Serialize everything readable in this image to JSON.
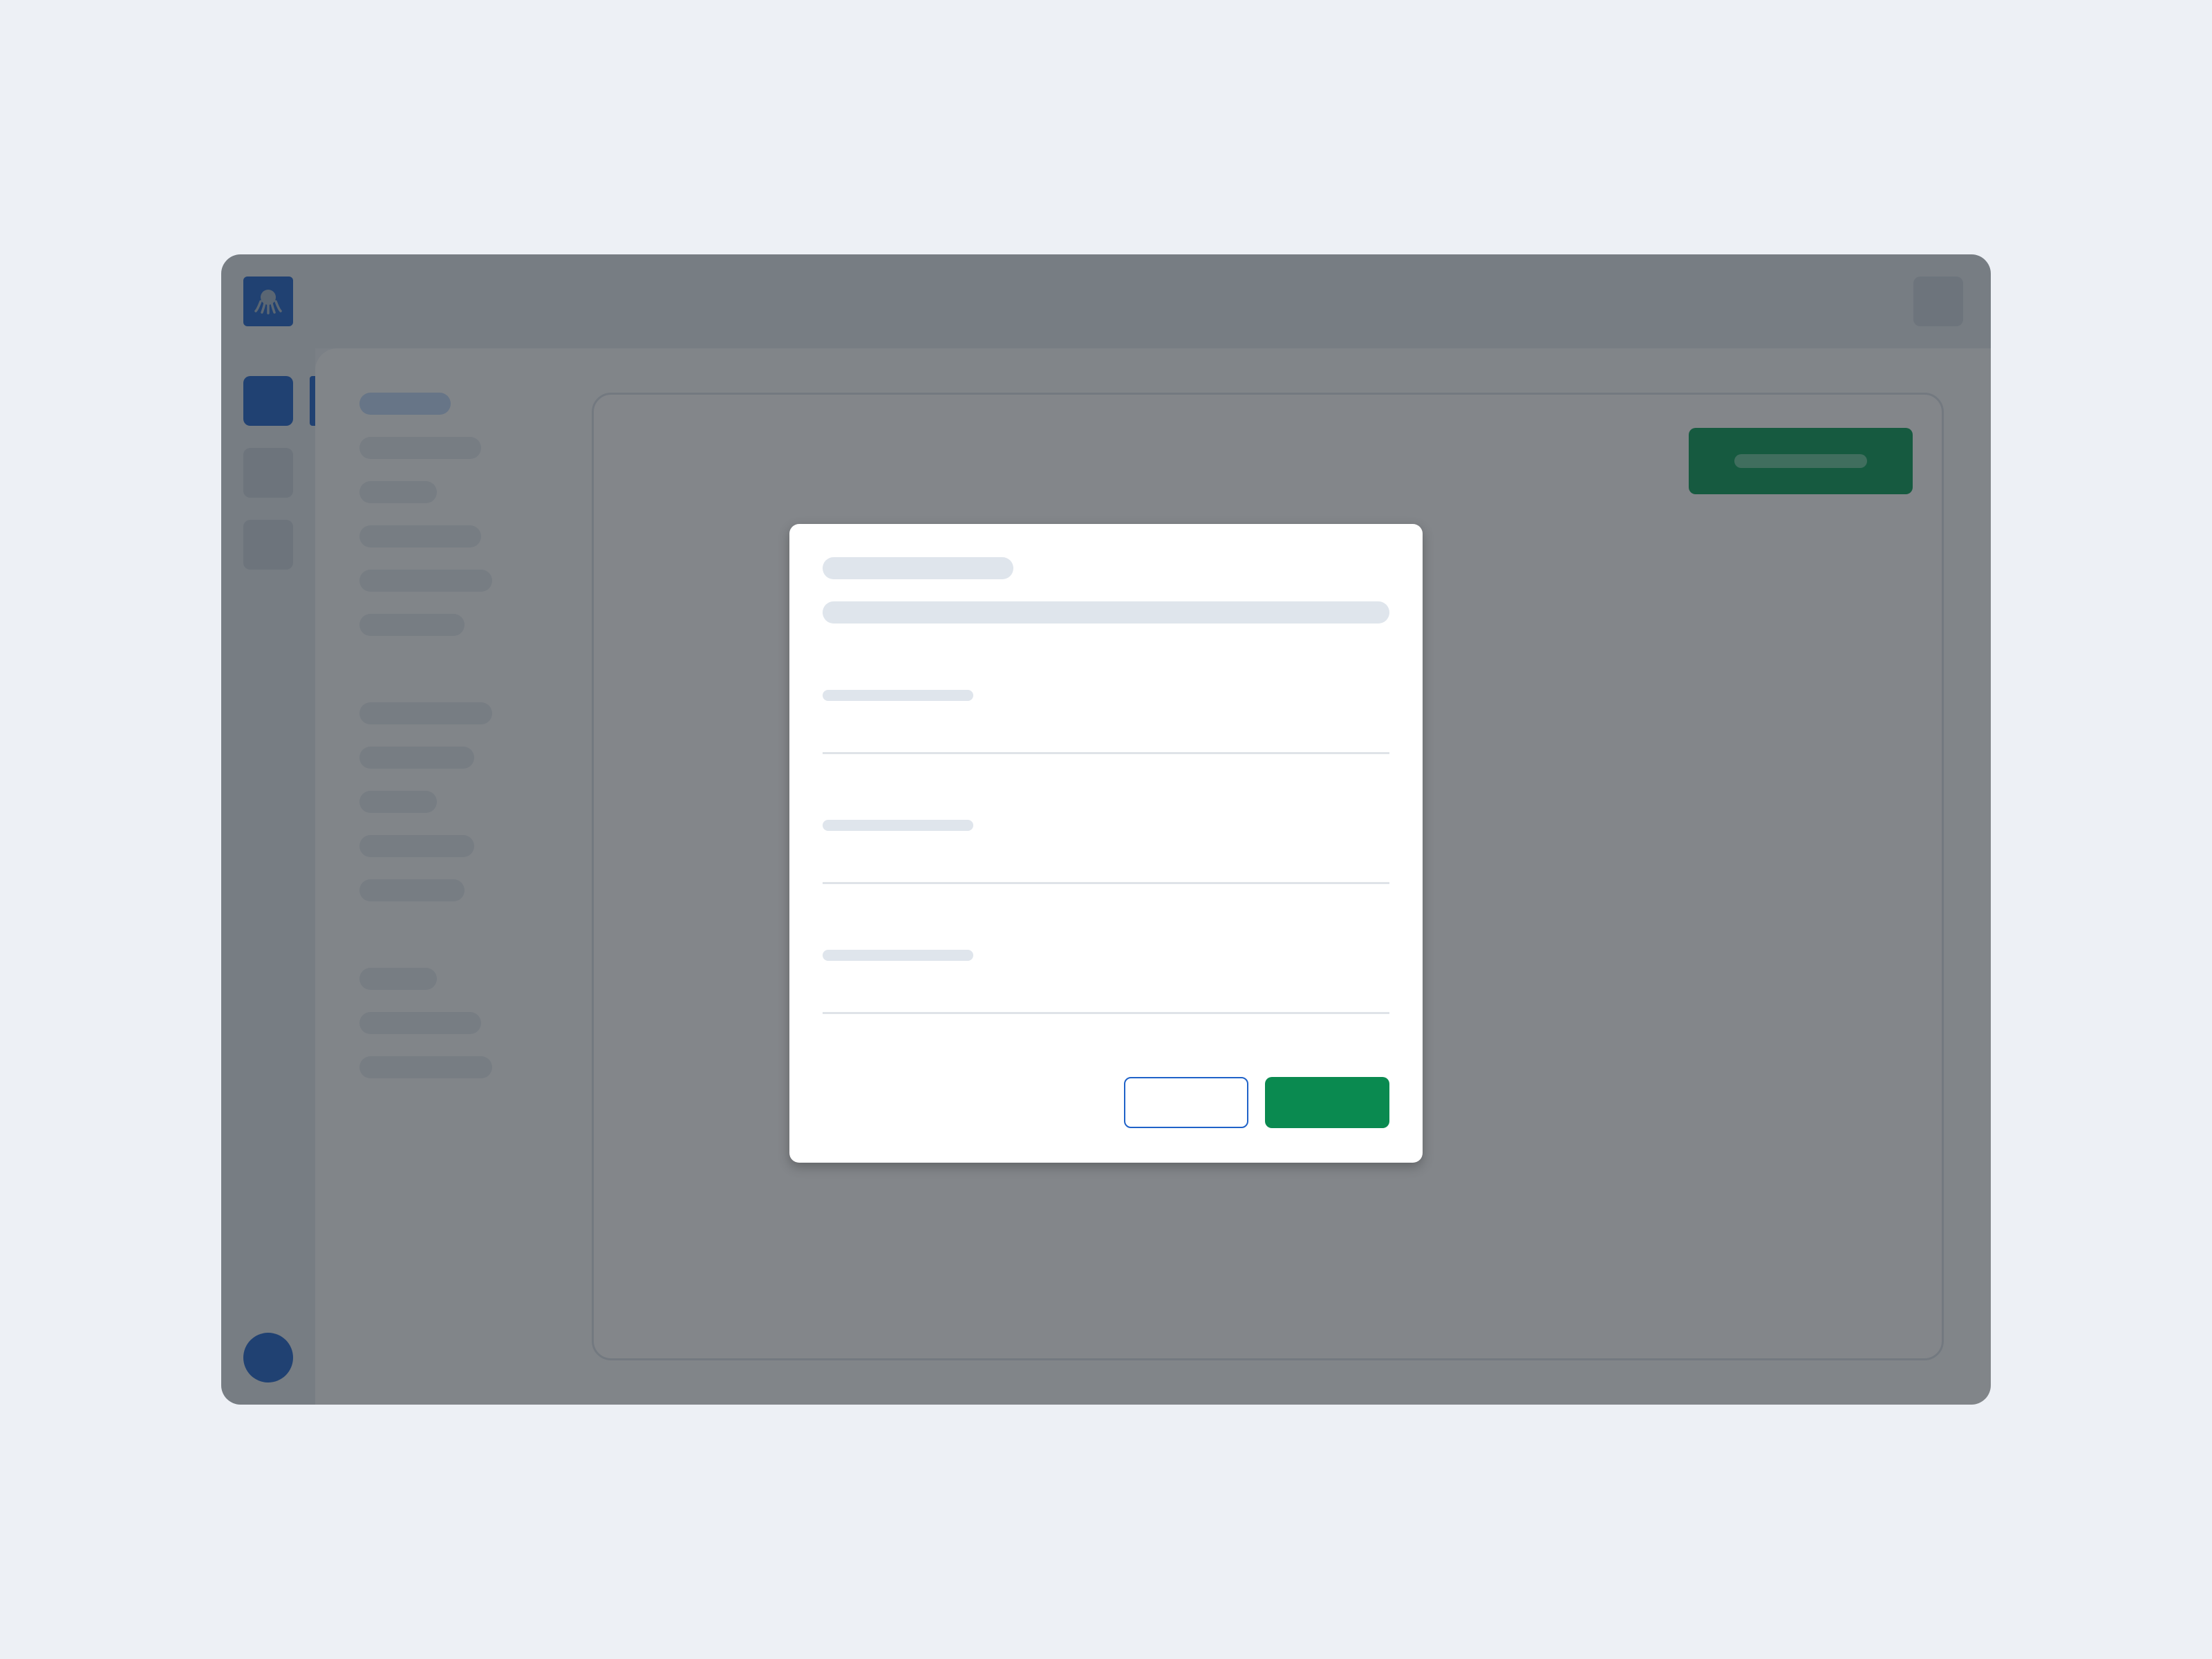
{
  "app": {
    "logo_icon": "octopus-icon",
    "brand_color": "#1f62c8",
    "accent_green": "#0a8a50"
  },
  "dialog": {
    "title": "",
    "description": "",
    "fields": [
      {
        "label": "",
        "value": ""
      },
      {
        "label": "",
        "value": ""
      },
      {
        "label": "",
        "value": ""
      }
    ],
    "cancel_label": "",
    "confirm_label": ""
  },
  "toolbar": {
    "primary_action_label": ""
  }
}
